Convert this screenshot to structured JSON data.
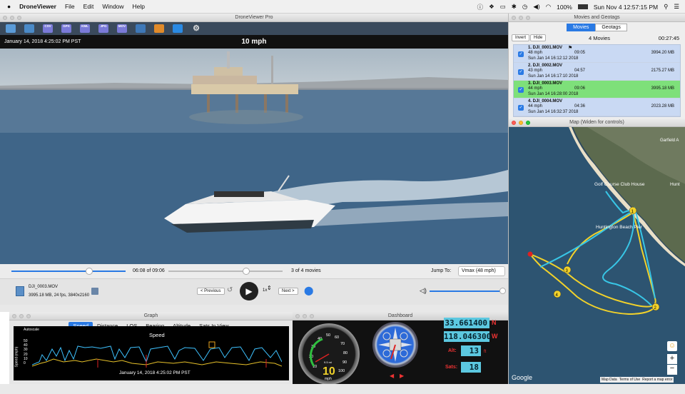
{
  "menubar": {
    "apple": "",
    "app_name": "DroneViewer",
    "menus": [
      "File",
      "Edit",
      "Window",
      "Help"
    ],
    "battery": "100%",
    "clock": "Sun Nov 4  12:57:15 PM"
  },
  "main_window": {
    "title": "DroneViewer Pro",
    "toolbar": [
      "CSV",
      "GPX",
      "KML",
      "JPG",
      "MOV"
    ],
    "video_date": "January 14, 2018 4:25:02 PM PST",
    "video_speed": "10 mph",
    "position": "06:08 of 09:06",
    "movie_count": "3 of 4 movies",
    "jump_to_label": "Jump To:",
    "jump_to_value": "Vmax (48 mph)",
    "file_name": "DJI_0003.MOV",
    "file_info": "3995.18 MB, 24 fps, 3840x2160",
    "prev_label": "< Previous",
    "next_label": "Next >",
    "rate": "1x",
    "scrub_fraction": 0.67
  },
  "movies_panel": {
    "title": "Movies and Geotags",
    "tabs": [
      "Movies",
      "Geotags"
    ],
    "invert": "Invert",
    "hide": "Hide",
    "count": "4 Movies",
    "total": "00:27:45",
    "items": [
      {
        "name": "1. DJI_0001.MOV",
        "mph": "48 mph",
        "dur": "09:05",
        "size": "3994.20 MB",
        "date": "Sun Jan 14 16:12:12 2018"
      },
      {
        "name": "2. DJI_0002.MOV",
        "mph": "43 mph",
        "dur": "04:57",
        "size": "2175.27 MB",
        "date": "Sun Jan 14 16:17:10 2018"
      },
      {
        "name": "3. DJI_0003.MOV",
        "mph": "44 mph",
        "dur": "09:06",
        "size": "3995.18 MB",
        "date": "Sun Jan 14 16:28:00 2018"
      },
      {
        "name": "4. DJI_0004.MOV",
        "mph": "44 mph",
        "dur": "04:36",
        "size": "2023.28 MB",
        "date": "Sun Jan 14 16:32:37 2018"
      }
    ]
  },
  "map": {
    "title": "Map (Widen for controls)",
    "labels": [
      "Garfield A",
      "Golf Course Club House",
      "Hunt",
      "Huntington Beach Pier"
    ],
    "markers": [
      "1",
      "2",
      "3",
      "4"
    ],
    "google": "Google",
    "footer": [
      "Map Data",
      "Terms of Use",
      "Report a map error"
    ]
  },
  "graph": {
    "title": "Graph",
    "tabs": [
      "Speed",
      "Distance",
      "LOS",
      "Bearing",
      "Altitude",
      "Sats In View"
    ],
    "autoscale": "Autoscale",
    "chart_title": "Speed",
    "ylabel": "Speed (mph)",
    "yticks": [
      "50",
      "40",
      "30",
      "20",
      "10",
      "0"
    ],
    "xlabel": "January 14, 2018 4:25:02 PM PST"
  },
  "dashboard": {
    "title": "Dashboard",
    "gauge_ticks": [
      "10",
      "20",
      "30",
      "40",
      "50",
      "60",
      "70",
      "80",
      "90",
      "100"
    ],
    "gauge_value": "10",
    "gauge_unit": "mph",
    "gauge_sub": "9.5 mi",
    "lat": "33.661400",
    "lat_dir": "N",
    "lon": "118.046300",
    "lon_dir": "W",
    "alt_label": "Alt:",
    "alt": "13",
    "alt_unit": "ft",
    "sats_label": "Sats:",
    "sats": "18"
  }
}
